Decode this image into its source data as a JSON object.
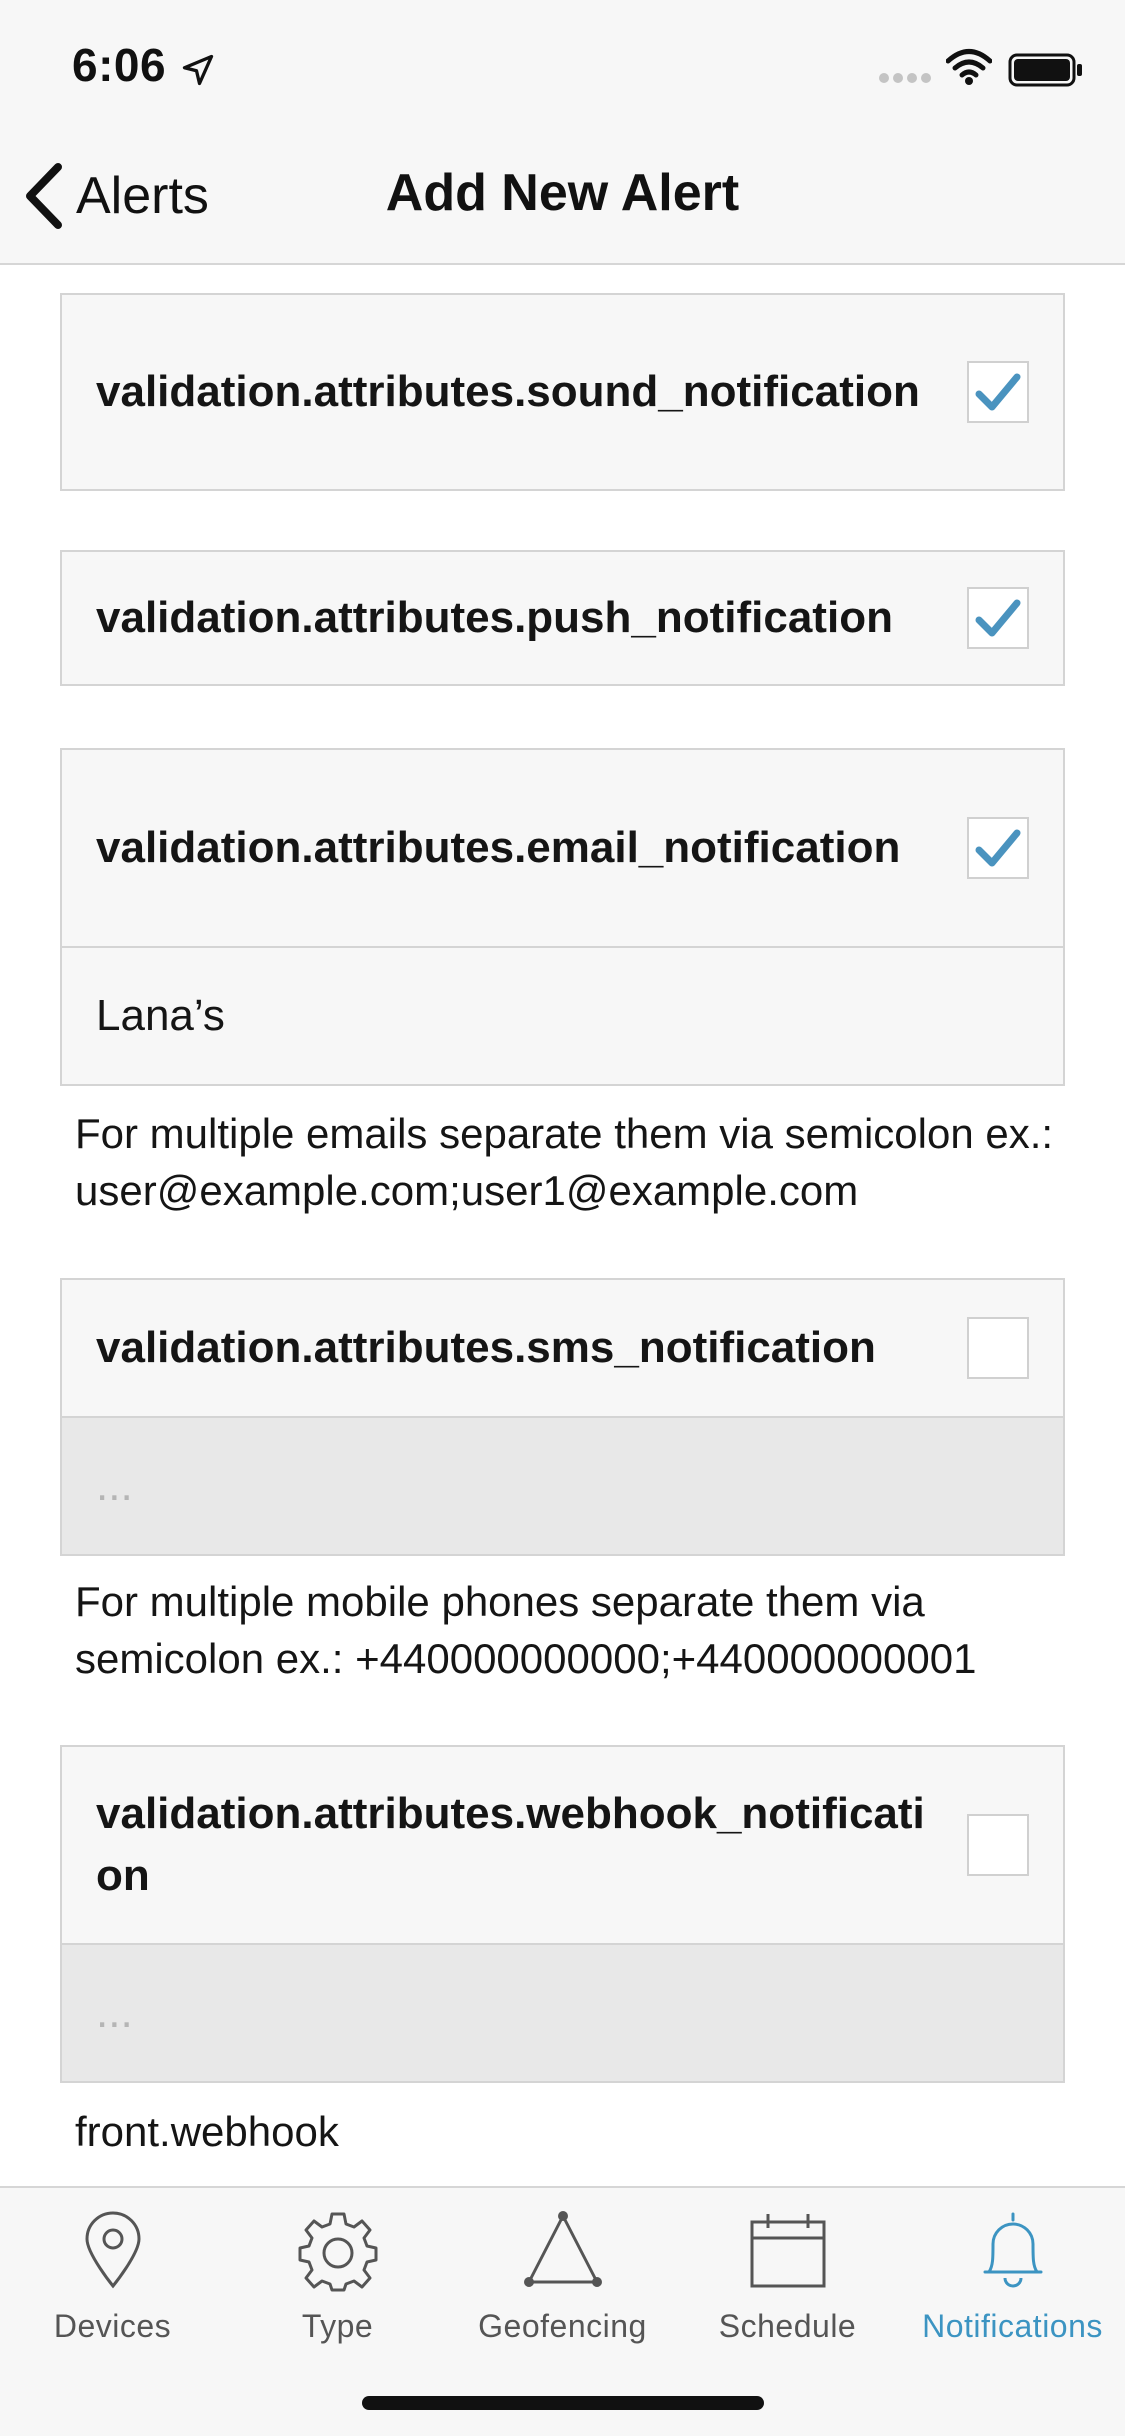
{
  "status_bar": {
    "time": "6:06"
  },
  "nav": {
    "back_label": "Alerts",
    "title": "Add New Alert"
  },
  "options": {
    "sound": {
      "label": "validation.attributes.sound_notification",
      "checked": true
    },
    "push": {
      "label": "validation.attributes.push_notification",
      "checked": true
    },
    "email": {
      "label": "validation.attributes.email_notification",
      "checked": true,
      "value": "Lana’s",
      "helper": "For multiple emails separate them via semicolon ex.: user@example.com;user1@example.com"
    },
    "sms": {
      "label": "validation.attributes.sms_notification",
      "checked": false,
      "placeholder": "...",
      "helper": "For multiple mobile phones separate them via semicolon ex.: +440000000000;+440000000001"
    },
    "webhook": {
      "label": "validation.attributes.webhook_notification",
      "checked": false,
      "placeholder": "...",
      "helper": "front.webhook"
    }
  },
  "tabs": [
    {
      "label": "Devices",
      "icon": "location-pin-icon",
      "active": false
    },
    {
      "label": "Type",
      "icon": "gear-icon",
      "active": false
    },
    {
      "label": "Geofencing",
      "icon": "triangle-icon",
      "active": false
    },
    {
      "label": "Schedule",
      "icon": "calendar-icon",
      "active": false
    },
    {
      "label": "Notifications",
      "icon": "bell-icon",
      "active": true
    }
  ],
  "colors": {
    "accent": "#3c94c2",
    "check": "#4a93bf",
    "bar_background": "#f7f7f7",
    "card_border": "#d4d4d4",
    "input_disabled": "#e8e8e8"
  }
}
